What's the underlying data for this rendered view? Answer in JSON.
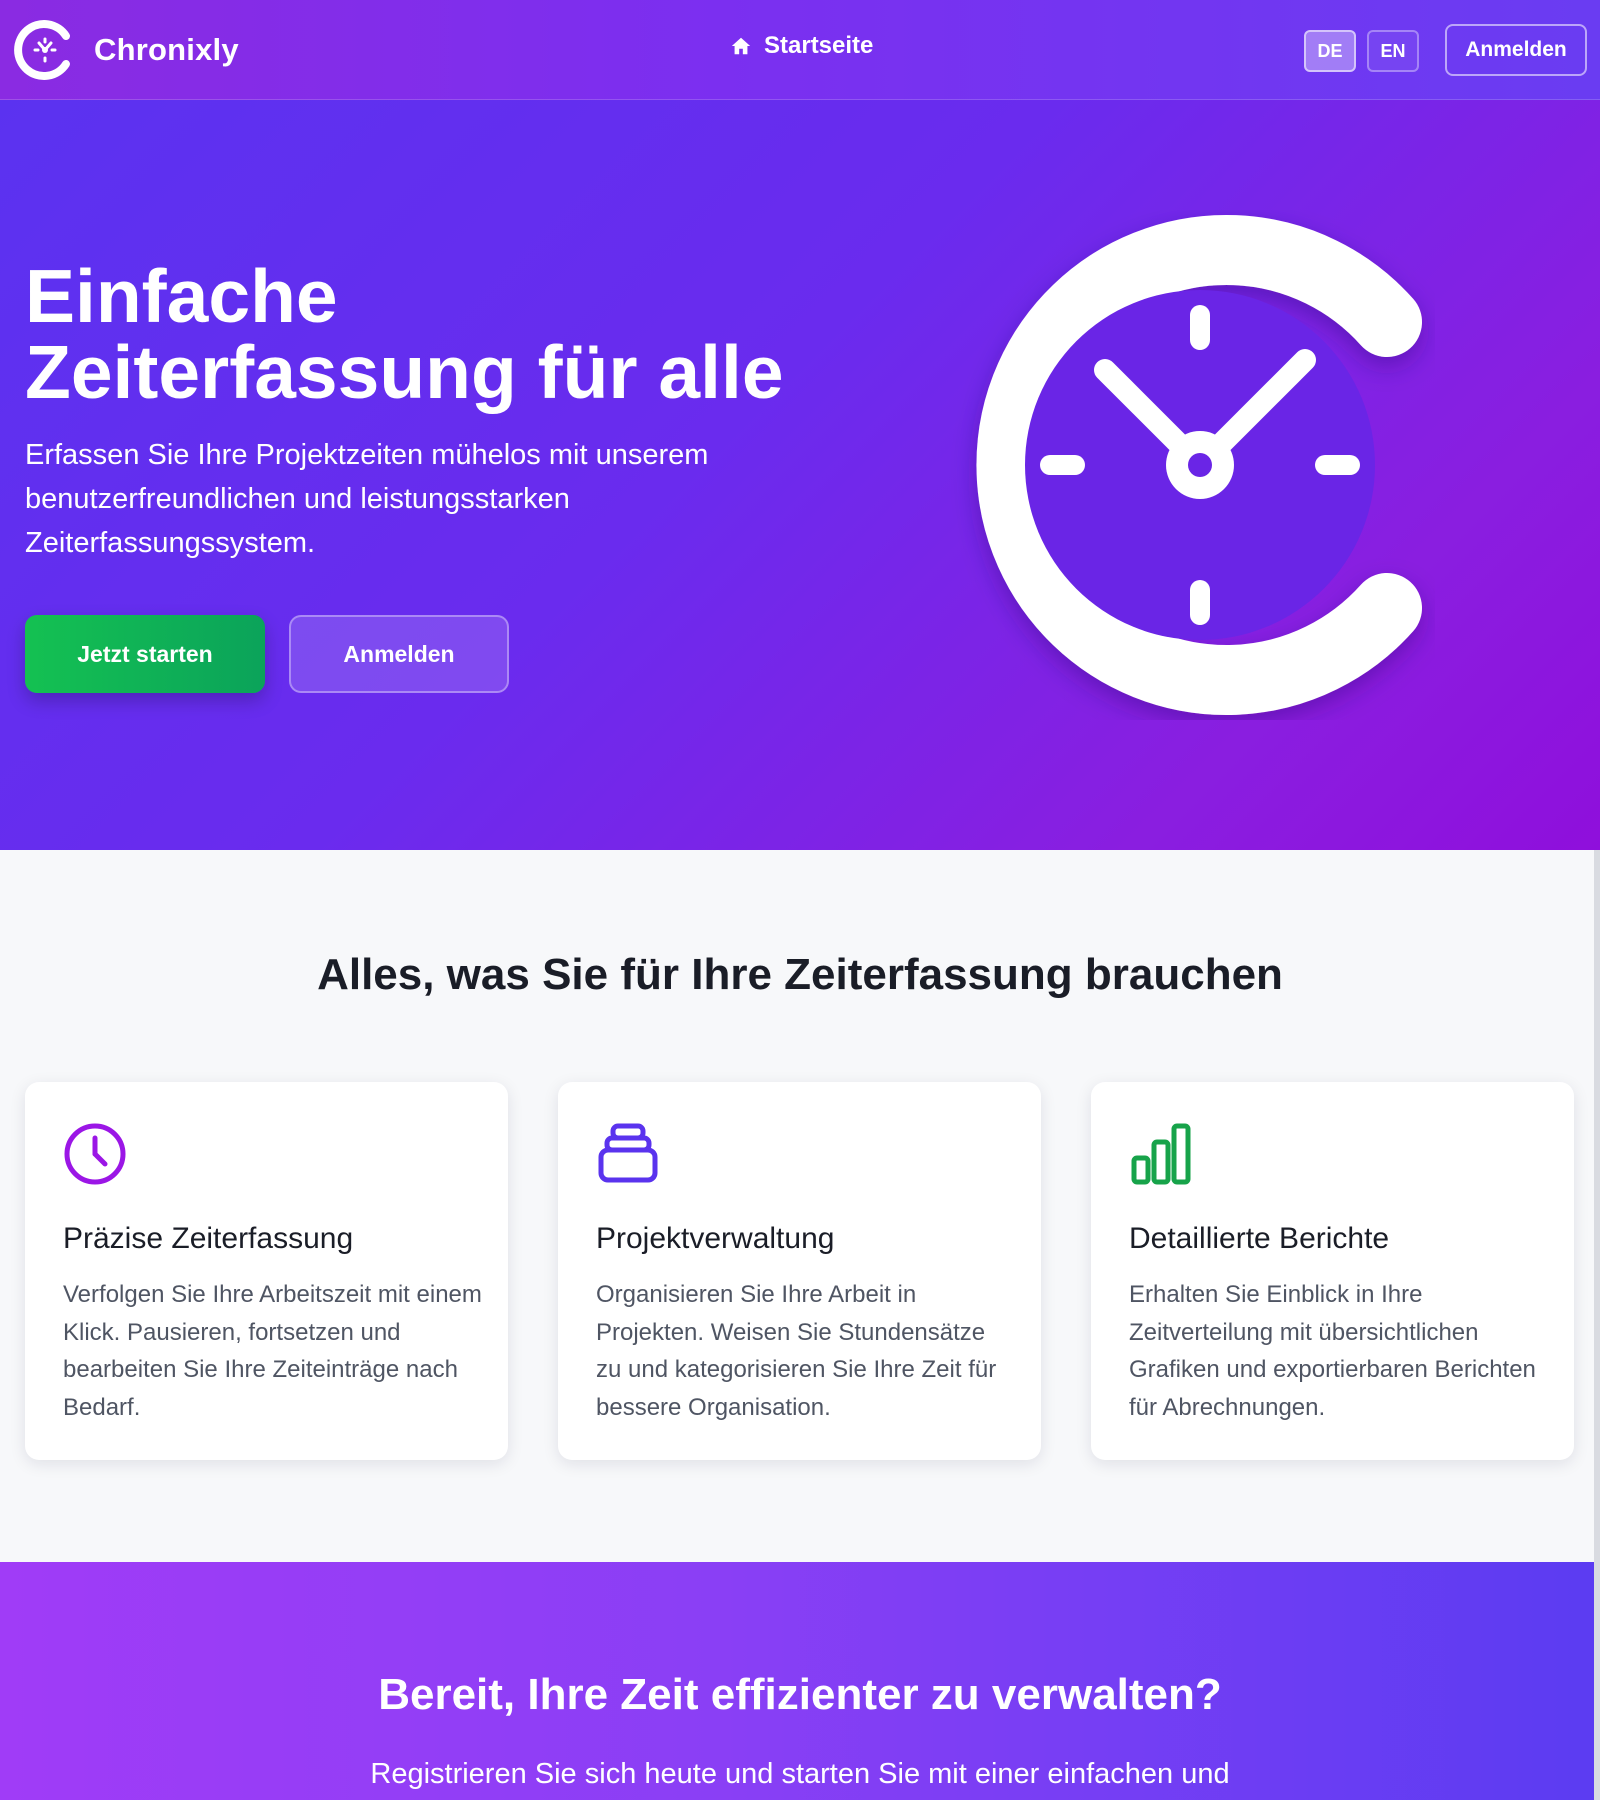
{
  "app": {
    "name": "Chronixly"
  },
  "nav": {
    "home_label": "Startseite",
    "lang_de": "DE",
    "lang_en": "EN",
    "active_lang": "DE",
    "login_label": "Anmelden"
  },
  "hero": {
    "title": "Einfache Zeiterfassung für alle",
    "subtitle": "Erfassen Sie Ihre Projektzeiten mühelos mit unserem benutzerfreundlichen und leistungsstarken Zeiterfassungssystem.",
    "primary_button": "Jetzt starten",
    "secondary_button": "Anmelden"
  },
  "features": {
    "title": "Alles, was Sie für Ihre Zeiterfassung brauchen",
    "items": [
      {
        "icon": "clock-icon",
        "title": "Präzise Zeiterfassung",
        "text": "Verfolgen Sie Ihre Arbeitszeit mit einem Klick. Pausieren, fortsetzen und bearbeiten Sie Ihre Zeiteinträge nach Bedarf.",
        "icon_color": "#9b16e6"
      },
      {
        "icon": "layers-icon",
        "title": "Projektverwaltung",
        "text": "Organisieren Sie Ihre Arbeit in Projekten. Weisen Sie Stundensätze zu und kategorisieren Sie Ihre Zeit für bessere Organisation.",
        "icon_color": "#5a33ee"
      },
      {
        "icon": "bar-chart-icon",
        "title": "Detaillierte Berichte",
        "text": "Erhalten Sie Einblick in Ihre Zeitverteilung mit übersichtlichen Grafiken und exportierbaren Berichten für Abrechnungen.",
        "icon_color": "#17a34a"
      }
    ]
  },
  "cta": {
    "title": "Bereit, Ihre Zeit effizienter zu verwalten?",
    "subtitle": "Registrieren Sie sich heute und starten Sie mit einer einfachen und"
  },
  "colors": {
    "brand_purple": "#7b2ff0",
    "accent_green": "#14c152"
  }
}
